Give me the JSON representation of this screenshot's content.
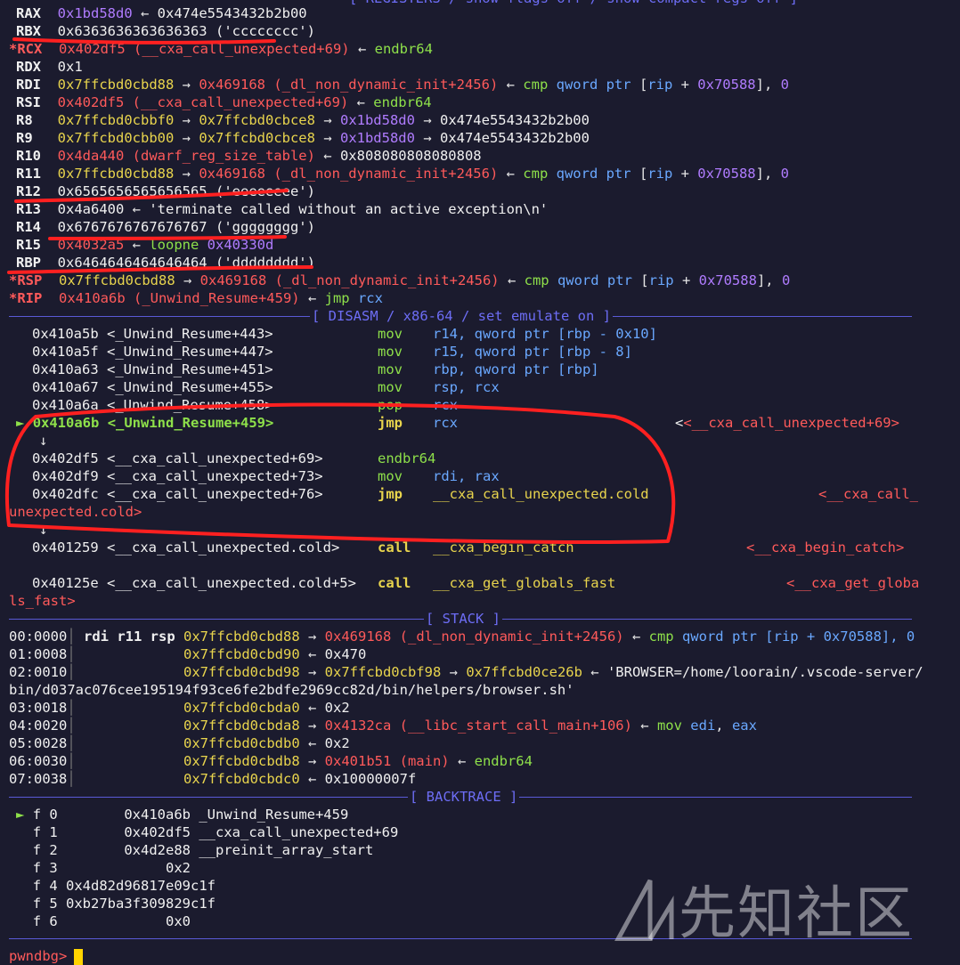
{
  "top_cut": "[ REGISTERS / show-flags off / show-compact-regs off ]",
  "registers": {
    "rax_name": "RAX",
    "rax_val": "0x1bd58d0",
    "rax_arrow": " ← ",
    "rax_tail": "0x474e5543432b2b00",
    "rbx_name": "RBX",
    "rbx_val": "0x6363636363636363",
    "rbx_tail": " ('cccccccc')",
    "rcx_name": "*RCX",
    "rcx_val": "0x402df5",
    "rcx_sym": " (__cxa_call_unexpected+69)",
    "rcx_arrow": " ← ",
    "rcx_ins": "endbr64",
    "rdx_name": "RDX",
    "rdx_val": "0x1",
    "rdi_name": "RDI",
    "rdi_val": "0x7ffcbd0cbd88",
    "rdi_a1": " → ",
    "rdi_v2": "0x469168",
    "rdi_sym": " (_dl_non_dynamic_init+2456)",
    "rdi_a2": " ← ",
    "rdi_ins": "cmp",
    "rdi_op1": " qword ptr ",
    "rdi_br": "[",
    "rdi_rip": "rip",
    "rdi_plus": " + ",
    "rdi_off": "0x70588",
    "rdi_br2": "], ",
    "rdi_zero": "0",
    "rsi_name": "RSI",
    "rsi_val": "0x402df5",
    "rsi_sym": " (__cxa_call_unexpected+69)",
    "rsi_arrow": " ← ",
    "rsi_ins": "endbr64",
    "r8_name": "R8",
    "r8_val": "0x7ffcbd0cbbf0",
    "r8_v2": "0x7ffcbd0cbce8",
    "r8_v3": "0x1bd58d0",
    "r8_tail": "0x474e5543432b2b00",
    "r9_name": "R9",
    "r9_val": "0x7ffcbd0cbb00",
    "r9_v2": "0x7ffcbd0cbce8",
    "r9_v3": "0x1bd58d0",
    "r9_tail": "0x474e5543432b2b00",
    "r10_name": "R10",
    "r10_val": "0x4da440",
    "r10_sym": " (dwarf_reg_size_table)",
    "r10_tail": "0x808080808080808",
    "r11_name": "R11",
    "r11_val": "0x7ffcbd0cbd88",
    "r11_v2": "0x469168",
    "r11_sym": " (_dl_non_dynamic_init+2456)",
    "r12_name": "R12",
    "r12_val": "0x6565656565656565",
    "r12_tail": " ('eeeeeeee')",
    "r13_name": "R13",
    "r13_val": "0x4a6400",
    "r13_tail": "'terminate called without an active exception\\n'",
    "r14_name": "R14",
    "r14_val": "0x6767676767676767",
    "r14_tail": " ('gggggggg')",
    "r15_name": "R15",
    "r15_val": "0x4032a5",
    "r15_ins": "loopne",
    "r15_tgt": " 0x40330d",
    "rbp_name": "RBP",
    "rbp_val": "0x6464646464646464",
    "rbp_tail": " ('dddddddd')",
    "rsp_name": "*RSP",
    "rsp_val": "0x7ffcbd0cbd88",
    "rsp_v2": "0x469168",
    "rsp_sym": " (_dl_non_dynamic_init+2456)",
    "rip_name": "*RIP",
    "rip_val": "0x410a6b",
    "rip_sym": " (_Unwind_Resume+459)",
    "rip_ins": "jmp",
    "rip_op": " rcx",
    "arrow_r": " → ",
    "arrow_l": " ← "
  },
  "disasm": {
    "header": "[ DISASM / x86-64 / set emulate on ]",
    "rows": [
      {
        "addr": "0x410a5b",
        "sym": "<_Unwind_Resume+443>",
        "ins": "mov",
        "ops": "r14, qword ptr [rbp - 0x10]"
      },
      {
        "addr": "0x410a5f",
        "sym": "<_Unwind_Resume+447>",
        "ins": "mov",
        "ops": "r15, qword ptr [rbp - 8]"
      },
      {
        "addr": "0x410a63",
        "sym": "<_Unwind_Resume+451>",
        "ins": "mov",
        "ops": "rbp, qword ptr [rbp]"
      },
      {
        "addr": "0x410a67",
        "sym": "<_Unwind_Resume+455>",
        "ins": "mov",
        "ops": "rsp, rcx"
      },
      {
        "addr": "0x410a6a",
        "sym": "<_Unwind_Resume+458>",
        "ins": "pop",
        "ops": "rcx"
      }
    ],
    "current": {
      "marker": "►",
      "addr": "0x410a6b",
      "sym": "<_Unwind_Resume+459>",
      "ins": "jmp",
      "ops": "rcx",
      "target": "<__cxa_call_unexpected+69>"
    },
    "down_arrow": "↓",
    "rows2": [
      {
        "addr": "0x402df5",
        "sym": "<__cxa_call_unexpected+69>",
        "ins": "endbr64",
        "ops": ""
      },
      {
        "addr": "0x402df9",
        "sym": "<__cxa_call_unexpected+73>",
        "ins": "mov",
        "ops": "rdi, rax"
      }
    ],
    "jmp_row": {
      "addr": "0x402dfc",
      "sym": "<__cxa_call_unexpected+76>",
      "ins": "jmp",
      "ops": "__cxa_call_unexpected.cold",
      "target_a": "<__cxa_call_",
      "target_b": "unexpected.cold>"
    },
    "call1": {
      "addr": "0x401259",
      "sym": "<__cxa_call_unexpected.cold>",
      "ins": "call",
      "ops": "__cxa_begin_catch",
      "target": "<__cxa_begin_catch>"
    },
    "call2": {
      "addr": "0x40125e",
      "sym": "<__cxa_call_unexpected.cold+5>",
      "ins": "call",
      "ops": "__cxa_get_globals_fast",
      "target_a": "<__cxa_get_globa",
      "target_b": "ls_fast>"
    }
  },
  "stack": {
    "header": "[ STACK ]",
    "r0": {
      "idx": "00:0000",
      "regs": "rdi r11 rsp",
      "addr": "0x7ffcbd0cbd88",
      "v2": "0x469168",
      "sym": " (_dl_non_dynamic_init+2456)",
      "ins": "cmp",
      "ops": " qword ptr [rip + 0x70588], 0"
    },
    "r1": {
      "idx": "01:0008",
      "addr": "0x7ffcbd0cbd90",
      "val": "0x470"
    },
    "r2": {
      "idx": "02:0010",
      "addr": "0x7ffcbd0cbd98",
      "v2": "0x7ffcbd0cbf98",
      "v3": "0x7ffcbd0ce26b",
      "str": "'BROWSER=/home/loorain/.vscode-server/",
      "str2": "bin/d037ac076cee195194f93ce6fe2bdfe2969cc82d/bin/helpers/browser.sh'"
    },
    "r3": {
      "idx": "03:0018",
      "addr": "0x7ffcbd0cbda0",
      "val": "0x2"
    },
    "r4": {
      "idx": "04:0020",
      "addr": "0x7ffcbd0cbda8",
      "v2": "0x4132ca",
      "sym": " (__libc_start_call_main+106)",
      "ins": "mov",
      "ops": "edi",
      "ops2": "eax"
    },
    "r5": {
      "idx": "05:0028",
      "addr": "0x7ffcbd0cbdb0",
      "val": "0x2"
    },
    "r6": {
      "idx": "06:0030",
      "addr": "0x7ffcbd0cbdb8",
      "v2": "0x401b51",
      "sym": " (main)",
      "ins": "endbr64"
    },
    "r7": {
      "idx": "07:0038",
      "addr": "0x7ffcbd0cbdc0",
      "val": "0x10000007f"
    }
  },
  "backtrace": {
    "header": "[ BACKTRACE ]",
    "frames": [
      {
        "mark": "►",
        "f": "f 0",
        "addr": "        0x410a6b",
        "sym": " _Unwind_Resume+459"
      },
      {
        "mark": " ",
        "f": "f 1",
        "addr": "        0x402df5",
        "sym": " __cxa_call_unexpected+69"
      },
      {
        "mark": " ",
        "f": "f 2",
        "addr": "        0x4d2e88",
        "sym": " __preinit_array_start"
      },
      {
        "mark": " ",
        "f": "f 3",
        "addr": "             0x2",
        "sym": ""
      },
      {
        "mark": " ",
        "f": "f 4",
        "addr": " 0x4d82d96817e09c1f",
        "sym": ""
      },
      {
        "mark": " ",
        "f": "f 5",
        "addr": " 0xb27ba3f309829c1f",
        "sym": ""
      },
      {
        "mark": " ",
        "f": "f 6",
        "addr": "             0x0",
        "sym": ""
      }
    ]
  },
  "prompt": "pwndbg>",
  "watermark": "先知社区",
  "colors": {
    "bg": "#1b1b2e",
    "yellow": "#e8d44d",
    "red": "#ff5a5a",
    "purple": "#b07cff",
    "green": "#8ee04a",
    "blue": "#6aa8ff",
    "rule": "#5a5ad6",
    "annotation": "#ff2020"
  }
}
